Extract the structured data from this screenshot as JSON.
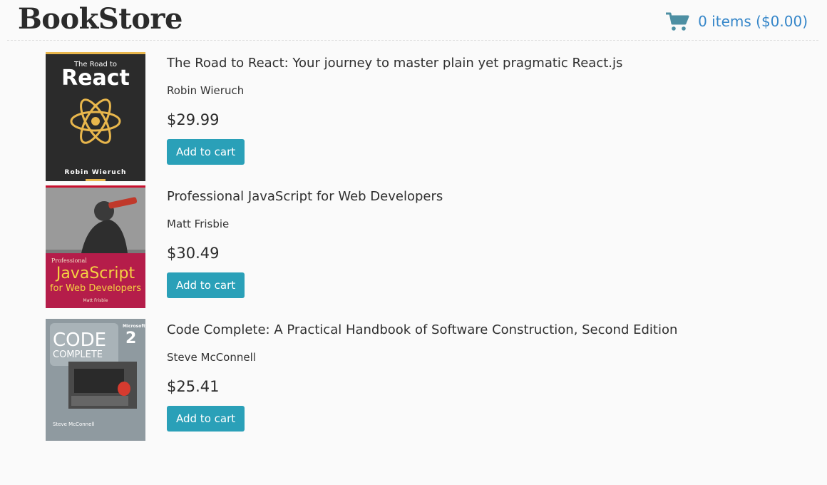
{
  "header": {
    "brand": "BookStore",
    "cart_icon": "shopping-cart-icon",
    "cart_summary": "0 items ($0.00)",
    "accent_color": "#3586c9"
  },
  "books": [
    {
      "title": "The Road to React: Your journey to master plain yet pragmatic React.js",
      "author": "Robin Wieruch",
      "price": "$29.99",
      "button": "Add to cart",
      "cover": {
        "top_text": "The Road to",
        "main_text": "React",
        "author_text": "Robin Wieruch"
      }
    },
    {
      "title": "Professional JavaScript for Web Developers",
      "author": "Matt Frisbie",
      "price": "$30.49",
      "button": "Add to cart",
      "cover": {
        "small_text": "Professional",
        "main_text": "JavaScript",
        "sub_text": "for Web Developers",
        "author_text": "Matt Frisbie"
      }
    },
    {
      "title": "Code Complete: A Practical Handbook of Software Construction, Second Edition",
      "author": "Steve McConnell",
      "price": "$25.41",
      "button": "Add to cart",
      "cover": {
        "line1": "CODE",
        "line2": "COMPLETE",
        "edition": "2",
        "publisher": "Microsoft",
        "author_text": "Steve McConnell"
      }
    }
  ],
  "colors": {
    "button_bg": "#2aa0b8",
    "button_text": "#ffffff"
  }
}
